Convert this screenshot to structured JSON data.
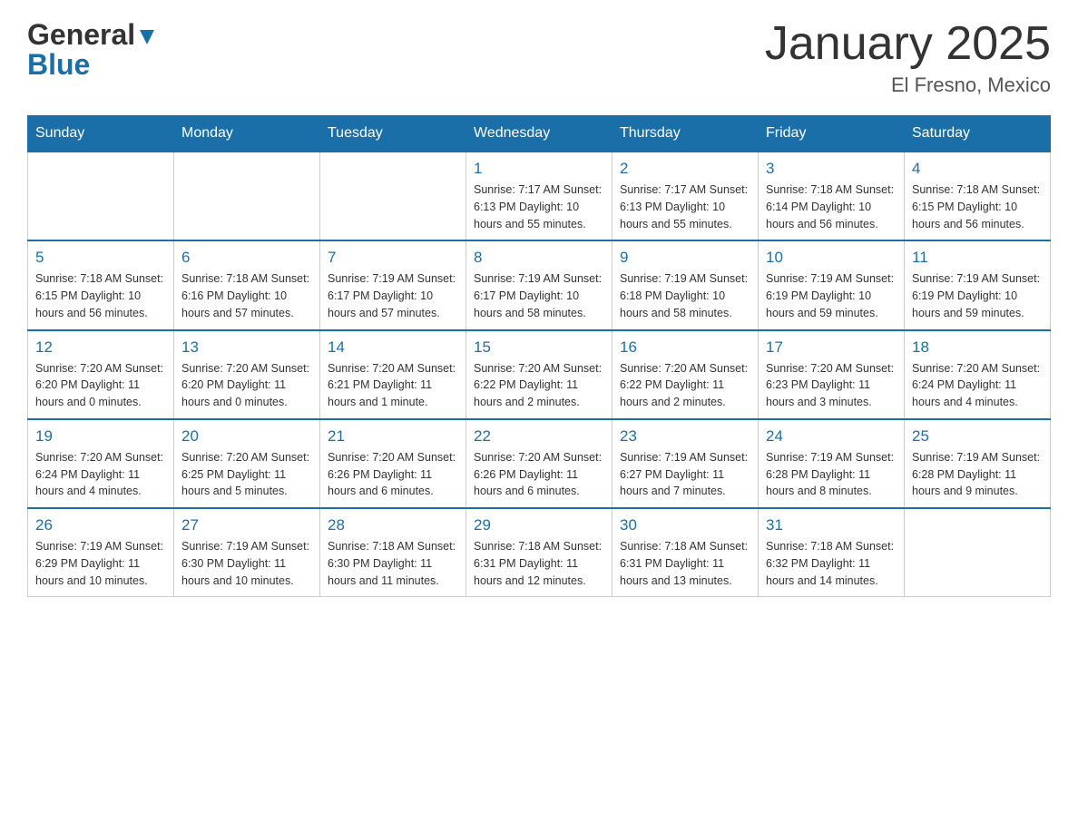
{
  "header": {
    "logo_general": "General",
    "logo_blue": "Blue",
    "title": "January 2025",
    "subtitle": "El Fresno, Mexico"
  },
  "days_header": [
    "Sunday",
    "Monday",
    "Tuesday",
    "Wednesday",
    "Thursday",
    "Friday",
    "Saturday"
  ],
  "weeks": [
    [
      {
        "day": "",
        "info": ""
      },
      {
        "day": "",
        "info": ""
      },
      {
        "day": "",
        "info": ""
      },
      {
        "day": "1",
        "info": "Sunrise: 7:17 AM\nSunset: 6:13 PM\nDaylight: 10 hours\nand 55 minutes."
      },
      {
        "day": "2",
        "info": "Sunrise: 7:17 AM\nSunset: 6:13 PM\nDaylight: 10 hours\nand 55 minutes."
      },
      {
        "day": "3",
        "info": "Sunrise: 7:18 AM\nSunset: 6:14 PM\nDaylight: 10 hours\nand 56 minutes."
      },
      {
        "day": "4",
        "info": "Sunrise: 7:18 AM\nSunset: 6:15 PM\nDaylight: 10 hours\nand 56 minutes."
      }
    ],
    [
      {
        "day": "5",
        "info": "Sunrise: 7:18 AM\nSunset: 6:15 PM\nDaylight: 10 hours\nand 56 minutes."
      },
      {
        "day": "6",
        "info": "Sunrise: 7:18 AM\nSunset: 6:16 PM\nDaylight: 10 hours\nand 57 minutes."
      },
      {
        "day": "7",
        "info": "Sunrise: 7:19 AM\nSunset: 6:17 PM\nDaylight: 10 hours\nand 57 minutes."
      },
      {
        "day": "8",
        "info": "Sunrise: 7:19 AM\nSunset: 6:17 PM\nDaylight: 10 hours\nand 58 minutes."
      },
      {
        "day": "9",
        "info": "Sunrise: 7:19 AM\nSunset: 6:18 PM\nDaylight: 10 hours\nand 58 minutes."
      },
      {
        "day": "10",
        "info": "Sunrise: 7:19 AM\nSunset: 6:19 PM\nDaylight: 10 hours\nand 59 minutes."
      },
      {
        "day": "11",
        "info": "Sunrise: 7:19 AM\nSunset: 6:19 PM\nDaylight: 10 hours\nand 59 minutes."
      }
    ],
    [
      {
        "day": "12",
        "info": "Sunrise: 7:20 AM\nSunset: 6:20 PM\nDaylight: 11 hours\nand 0 minutes."
      },
      {
        "day": "13",
        "info": "Sunrise: 7:20 AM\nSunset: 6:20 PM\nDaylight: 11 hours\nand 0 minutes."
      },
      {
        "day": "14",
        "info": "Sunrise: 7:20 AM\nSunset: 6:21 PM\nDaylight: 11 hours\nand 1 minute."
      },
      {
        "day": "15",
        "info": "Sunrise: 7:20 AM\nSunset: 6:22 PM\nDaylight: 11 hours\nand 2 minutes."
      },
      {
        "day": "16",
        "info": "Sunrise: 7:20 AM\nSunset: 6:22 PM\nDaylight: 11 hours\nand 2 minutes."
      },
      {
        "day": "17",
        "info": "Sunrise: 7:20 AM\nSunset: 6:23 PM\nDaylight: 11 hours\nand 3 minutes."
      },
      {
        "day": "18",
        "info": "Sunrise: 7:20 AM\nSunset: 6:24 PM\nDaylight: 11 hours\nand 4 minutes."
      }
    ],
    [
      {
        "day": "19",
        "info": "Sunrise: 7:20 AM\nSunset: 6:24 PM\nDaylight: 11 hours\nand 4 minutes."
      },
      {
        "day": "20",
        "info": "Sunrise: 7:20 AM\nSunset: 6:25 PM\nDaylight: 11 hours\nand 5 minutes."
      },
      {
        "day": "21",
        "info": "Sunrise: 7:20 AM\nSunset: 6:26 PM\nDaylight: 11 hours\nand 6 minutes."
      },
      {
        "day": "22",
        "info": "Sunrise: 7:20 AM\nSunset: 6:26 PM\nDaylight: 11 hours\nand 6 minutes."
      },
      {
        "day": "23",
        "info": "Sunrise: 7:19 AM\nSunset: 6:27 PM\nDaylight: 11 hours\nand 7 minutes."
      },
      {
        "day": "24",
        "info": "Sunrise: 7:19 AM\nSunset: 6:28 PM\nDaylight: 11 hours\nand 8 minutes."
      },
      {
        "day": "25",
        "info": "Sunrise: 7:19 AM\nSunset: 6:28 PM\nDaylight: 11 hours\nand 9 minutes."
      }
    ],
    [
      {
        "day": "26",
        "info": "Sunrise: 7:19 AM\nSunset: 6:29 PM\nDaylight: 11 hours\nand 10 minutes."
      },
      {
        "day": "27",
        "info": "Sunrise: 7:19 AM\nSunset: 6:30 PM\nDaylight: 11 hours\nand 10 minutes."
      },
      {
        "day": "28",
        "info": "Sunrise: 7:18 AM\nSunset: 6:30 PM\nDaylight: 11 hours\nand 11 minutes."
      },
      {
        "day": "29",
        "info": "Sunrise: 7:18 AM\nSunset: 6:31 PM\nDaylight: 11 hours\nand 12 minutes."
      },
      {
        "day": "30",
        "info": "Sunrise: 7:18 AM\nSunset: 6:31 PM\nDaylight: 11 hours\nand 13 minutes."
      },
      {
        "day": "31",
        "info": "Sunrise: 7:18 AM\nSunset: 6:32 PM\nDaylight: 11 hours\nand 14 minutes."
      },
      {
        "day": "",
        "info": ""
      }
    ]
  ]
}
